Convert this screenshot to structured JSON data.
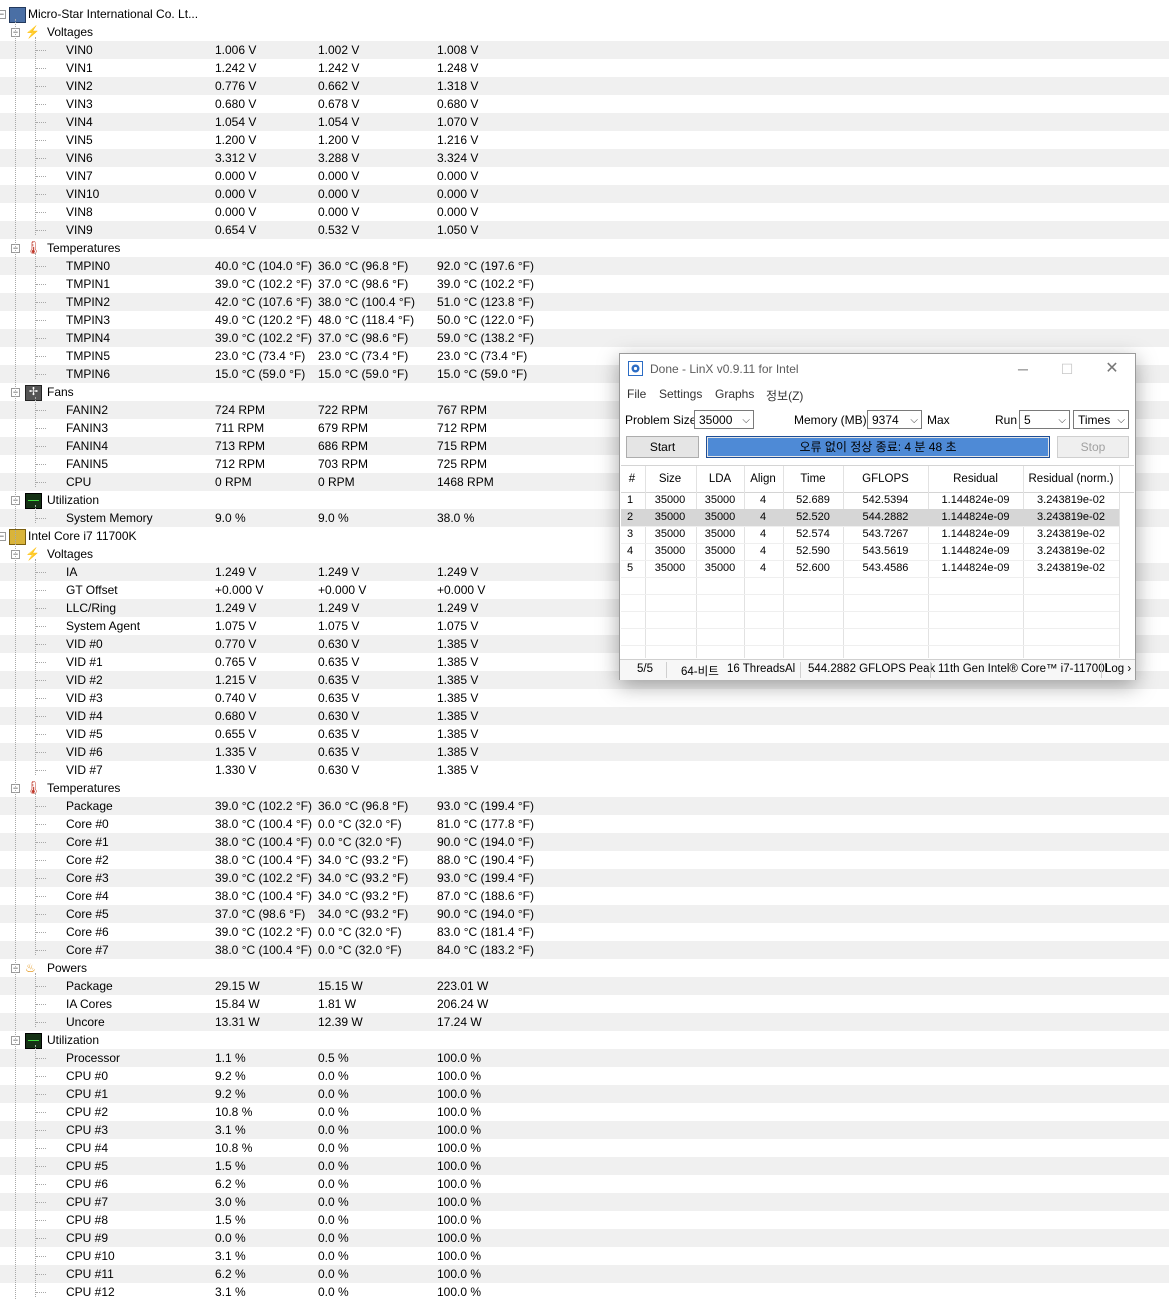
{
  "tree": [
    {
      "kind": "device",
      "icon": "motherboard-icon",
      "label": "Micro-Star International Co. Lt..."
    },
    {
      "kind": "group",
      "icon": "voltage-icon",
      "label": "Voltages"
    },
    {
      "kind": "sensor",
      "label": "VIN0",
      "v": [
        "1.006 V",
        "1.002 V",
        "1.008 V"
      ]
    },
    {
      "kind": "sensor",
      "label": "VIN1",
      "v": [
        "1.242 V",
        "1.242 V",
        "1.248 V"
      ]
    },
    {
      "kind": "sensor",
      "label": "VIN2",
      "v": [
        "0.776 V",
        "0.662 V",
        "1.318 V"
      ]
    },
    {
      "kind": "sensor",
      "label": "VIN3",
      "v": [
        "0.680 V",
        "0.678 V",
        "0.680 V"
      ]
    },
    {
      "kind": "sensor",
      "label": "VIN4",
      "v": [
        "1.054 V",
        "1.054 V",
        "1.070 V"
      ]
    },
    {
      "kind": "sensor",
      "label": "VIN5",
      "v": [
        "1.200 V",
        "1.200 V",
        "1.216 V"
      ]
    },
    {
      "kind": "sensor",
      "label": "VIN6",
      "v": [
        "3.312 V",
        "3.288 V",
        "3.324 V"
      ]
    },
    {
      "kind": "sensor",
      "label": "VIN7",
      "v": [
        "0.000 V",
        "0.000 V",
        "0.000 V"
      ]
    },
    {
      "kind": "sensor",
      "label": "VIN10",
      "v": [
        "0.000 V",
        "0.000 V",
        "0.000 V"
      ]
    },
    {
      "kind": "sensor",
      "label": "VIN8",
      "v": [
        "0.000 V",
        "0.000 V",
        "0.000 V"
      ]
    },
    {
      "kind": "sensor",
      "label": "VIN9",
      "v": [
        "0.654 V",
        "0.532 V",
        "1.050 V"
      ]
    },
    {
      "kind": "group",
      "icon": "thermometer-icon",
      "label": "Temperatures"
    },
    {
      "kind": "sensor",
      "label": "TMPIN0",
      "v": [
        "40.0 °C  (104.0 °F)",
        "36.0 °C  (96.8 °F)",
        "92.0 °C  (197.6 °F)"
      ]
    },
    {
      "kind": "sensor",
      "label": "TMPIN1",
      "v": [
        "39.0 °C  (102.2 °F)",
        "37.0 °C  (98.6 °F)",
        "39.0 °C  (102.2 °F)"
      ]
    },
    {
      "kind": "sensor",
      "label": "TMPIN2",
      "v": [
        "42.0 °C  (107.6 °F)",
        "38.0 °C  (100.4 °F)",
        "51.0 °C  (123.8 °F)"
      ]
    },
    {
      "kind": "sensor",
      "label": "TMPIN3",
      "v": [
        "49.0 °C  (120.2 °F)",
        "48.0 °C  (118.4 °F)",
        "50.0 °C  (122.0 °F)"
      ]
    },
    {
      "kind": "sensor",
      "label": "TMPIN4",
      "v": [
        "39.0 °C  (102.2 °F)",
        "37.0 °C  (98.6 °F)",
        "59.0 °C  (138.2 °F)"
      ]
    },
    {
      "kind": "sensor",
      "label": "TMPIN5",
      "v": [
        "23.0 °C  (73.4 °F)",
        "23.0 °C  (73.4 °F)",
        "23.0 °C  (73.4 °F)"
      ]
    },
    {
      "kind": "sensor",
      "label": "TMPIN6",
      "v": [
        "15.0 °C  (59.0 °F)",
        "15.0 °C  (59.0 °F)",
        "15.0 °C  (59.0 °F)"
      ]
    },
    {
      "kind": "group",
      "icon": "fan-icon",
      "label": "Fans"
    },
    {
      "kind": "sensor",
      "label": "FANIN2",
      "v": [
        "724 RPM",
        "722 RPM",
        "767 RPM"
      ]
    },
    {
      "kind": "sensor",
      "label": "FANIN3",
      "v": [
        "711 RPM",
        "679 RPM",
        "712 RPM"
      ]
    },
    {
      "kind": "sensor",
      "label": "FANIN4",
      "v": [
        "713 RPM",
        "686 RPM",
        "715 RPM"
      ]
    },
    {
      "kind": "sensor",
      "label": "FANIN5",
      "v": [
        "712 RPM",
        "703 RPM",
        "725 RPM"
      ]
    },
    {
      "kind": "sensor",
      "label": "CPU",
      "v": [
        "0 RPM",
        "0 RPM",
        "1468 RPM"
      ]
    },
    {
      "kind": "group",
      "icon": "utilization-icon",
      "label": "Utilization"
    },
    {
      "kind": "sensor",
      "label": "System Memory",
      "v": [
        "9.0 %",
        "9.0 %",
        "38.0 %"
      ]
    },
    {
      "kind": "device",
      "icon": "cpu-chip-icon",
      "label": "Intel Core i7 11700K"
    },
    {
      "kind": "group",
      "icon": "voltage-icon",
      "label": "Voltages"
    },
    {
      "kind": "sensor",
      "label": "IA",
      "v": [
        "1.249 V",
        "1.249 V",
        "1.249 V"
      ]
    },
    {
      "kind": "sensor",
      "label": "GT Offset",
      "v": [
        "+0.000 V",
        "+0.000 V",
        "+0.000 V"
      ]
    },
    {
      "kind": "sensor",
      "label": "LLC/Ring",
      "v": [
        "1.249 V",
        "1.249 V",
        "1.249 V"
      ]
    },
    {
      "kind": "sensor",
      "label": "System Agent",
      "v": [
        "1.075 V",
        "1.075 V",
        "1.075 V"
      ]
    },
    {
      "kind": "sensor",
      "label": "VID #0",
      "v": [
        "0.770 V",
        "0.630 V",
        "1.385 V"
      ]
    },
    {
      "kind": "sensor",
      "label": "VID #1",
      "v": [
        "0.765 V",
        "0.635 V",
        "1.385 V"
      ]
    },
    {
      "kind": "sensor",
      "label": "VID #2",
      "v": [
        "1.215 V",
        "0.635 V",
        "1.385 V"
      ]
    },
    {
      "kind": "sensor",
      "label": "VID #3",
      "v": [
        "0.740 V",
        "0.635 V",
        "1.385 V"
      ]
    },
    {
      "kind": "sensor",
      "label": "VID #4",
      "v": [
        "0.680 V",
        "0.630 V",
        "1.385 V"
      ]
    },
    {
      "kind": "sensor",
      "label": "VID #5",
      "v": [
        "0.655 V",
        "0.635 V",
        "1.385 V"
      ]
    },
    {
      "kind": "sensor",
      "label": "VID #6",
      "v": [
        "1.335 V",
        "0.635 V",
        "1.385 V"
      ]
    },
    {
      "kind": "sensor",
      "label": "VID #7",
      "v": [
        "1.330 V",
        "0.630 V",
        "1.385 V"
      ]
    },
    {
      "kind": "group",
      "icon": "thermometer-icon",
      "label": "Temperatures"
    },
    {
      "kind": "sensor",
      "label": "Package",
      "v": [
        "39.0 °C  (102.2 °F)",
        "36.0 °C  (96.8 °F)",
        "93.0 °C  (199.4 °F)"
      ]
    },
    {
      "kind": "sensor",
      "label": "Core #0",
      "v": [
        "38.0 °C  (100.4 °F)",
        "0.0 °C  (32.0 °F)",
        "81.0 °C  (177.8 °F)"
      ]
    },
    {
      "kind": "sensor",
      "label": "Core #1",
      "v": [
        "38.0 °C  (100.4 °F)",
        "0.0 °C  (32.0 °F)",
        "90.0 °C  (194.0 °F)"
      ]
    },
    {
      "kind": "sensor",
      "label": "Core #2",
      "v": [
        "38.0 °C  (100.4 °F)",
        "34.0 °C  (93.2 °F)",
        "88.0 °C  (190.4 °F)"
      ]
    },
    {
      "kind": "sensor",
      "label": "Core #3",
      "v": [
        "39.0 °C  (102.2 °F)",
        "34.0 °C  (93.2 °F)",
        "93.0 °C  (199.4 °F)"
      ]
    },
    {
      "kind": "sensor",
      "label": "Core #4",
      "v": [
        "38.0 °C  (100.4 °F)",
        "34.0 °C  (93.2 °F)",
        "87.0 °C  (188.6 °F)"
      ]
    },
    {
      "kind": "sensor",
      "label": "Core #5",
      "v": [
        "37.0 °C  (98.6 °F)",
        "34.0 °C  (93.2 °F)",
        "90.0 °C  (194.0 °F)"
      ]
    },
    {
      "kind": "sensor",
      "label": "Core #6",
      "v": [
        "39.0 °C  (102.2 °F)",
        "0.0 °C  (32.0 °F)",
        "83.0 °C  (181.4 °F)"
      ]
    },
    {
      "kind": "sensor",
      "label": "Core #7",
      "v": [
        "38.0 °C  (100.4 °F)",
        "0.0 °C  (32.0 °F)",
        "84.0 °C  (183.2 °F)"
      ]
    },
    {
      "kind": "group",
      "icon": "power-icon",
      "label": "Powers"
    },
    {
      "kind": "sensor",
      "label": "Package",
      "v": [
        "29.15 W",
        "15.15 W",
        "223.01 W"
      ]
    },
    {
      "kind": "sensor",
      "label": "IA Cores",
      "v": [
        "15.84 W",
        "1.81 W",
        "206.24 W"
      ]
    },
    {
      "kind": "sensor",
      "label": "Uncore",
      "v": [
        "13.31 W",
        "12.39 W",
        "17.24 W"
      ]
    },
    {
      "kind": "group",
      "icon": "utilization-icon",
      "label": "Utilization"
    },
    {
      "kind": "sensor",
      "label": "Processor",
      "v": [
        "1.1 %",
        "0.5 %",
        "100.0 %"
      ]
    },
    {
      "kind": "sensor",
      "label": "CPU #0",
      "v": [
        "9.2 %",
        "0.0 %",
        "100.0 %"
      ]
    },
    {
      "kind": "sensor",
      "label": "CPU #1",
      "v": [
        "9.2 %",
        "0.0 %",
        "100.0 %"
      ]
    },
    {
      "kind": "sensor",
      "label": "CPU #2",
      "v": [
        "10.8 %",
        "0.0 %",
        "100.0 %"
      ]
    },
    {
      "kind": "sensor",
      "label": "CPU #3",
      "v": [
        "3.1 %",
        "0.0 %",
        "100.0 %"
      ]
    },
    {
      "kind": "sensor",
      "label": "CPU #4",
      "v": [
        "10.8 %",
        "0.0 %",
        "100.0 %"
      ]
    },
    {
      "kind": "sensor",
      "label": "CPU #5",
      "v": [
        "1.5 %",
        "0.0 %",
        "100.0 %"
      ]
    },
    {
      "kind": "sensor",
      "label": "CPU #6",
      "v": [
        "6.2 %",
        "0.0 %",
        "100.0 %"
      ]
    },
    {
      "kind": "sensor",
      "label": "CPU #7",
      "v": [
        "3.0 %",
        "0.0 %",
        "100.0 %"
      ]
    },
    {
      "kind": "sensor",
      "label": "CPU #8",
      "v": [
        "1.5 %",
        "0.0 %",
        "100.0 %"
      ]
    },
    {
      "kind": "sensor",
      "label": "CPU #9",
      "v": [
        "0.0 %",
        "0.0 %",
        "100.0 %"
      ]
    },
    {
      "kind": "sensor",
      "label": "CPU #10",
      "v": [
        "3.1 %",
        "0.0 %",
        "100.0 %"
      ]
    },
    {
      "kind": "sensor",
      "label": "CPU #11",
      "v": [
        "6.2 %",
        "0.0 %",
        "100.0 %"
      ]
    },
    {
      "kind": "sensor",
      "label": "CPU #12",
      "v": [
        "3.1 %",
        "0.0 %",
        "100.0 %"
      ]
    }
  ],
  "linx": {
    "title": "Done - LinX v0.9.11 for Intel",
    "menu": [
      "File",
      "Settings",
      "Graphs",
      "정보(Z)"
    ],
    "problem_size_label": "Problem Size:",
    "problem_size_value": "35000",
    "memory_label": "Memory (MB):",
    "memory_value": "9374",
    "max_label": "Max",
    "run_label": "Run",
    "run_value": "5",
    "times_value": "Times",
    "start_label": "Start",
    "stop_label": "Stop",
    "progress_text": "오류 없이 정상 종료: 4 분 48 초",
    "progress": 1.0,
    "columns": [
      "#",
      "Size",
      "LDA",
      "Align",
      "Time",
      "GFLOPS",
      "Residual",
      "Residual (norm.)"
    ],
    "results": [
      [
        "1",
        "35000",
        "35000",
        "4",
        "52.689",
        "542.5394",
        "1.144824e-09",
        "3.243819e-02"
      ],
      [
        "2",
        "35000",
        "35000",
        "4",
        "52.520",
        "544.2882",
        "1.144824e-09",
        "3.243819e-02"
      ],
      [
        "3",
        "35000",
        "35000",
        "4",
        "52.574",
        "543.7267",
        "1.144824e-09",
        "3.243819e-02"
      ],
      [
        "4",
        "35000",
        "35000",
        "4",
        "52.590",
        "543.5619",
        "1.144824e-09",
        "3.243819e-02"
      ],
      [
        "5",
        "35000",
        "35000",
        "4",
        "52.600",
        "543.4586",
        "1.144824e-09",
        "3.243819e-02"
      ]
    ],
    "selected_result": 2,
    "status": [
      "5/5",
      "64-비트",
      "16 ThreadsAl",
      "544.2882 GFLOPS Peak",
      "11th Gen Intel® Core™ i7-11700l",
      "Log ›"
    ]
  }
}
